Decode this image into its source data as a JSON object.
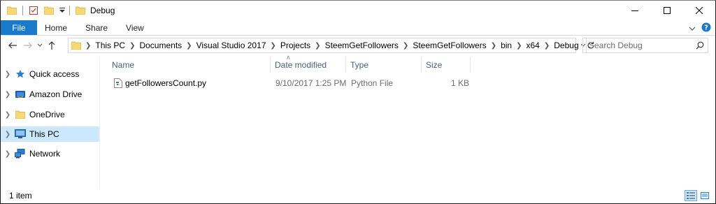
{
  "window": {
    "title": "Debug"
  },
  "ribbon": {
    "tabs": [
      "File",
      "Home",
      "Share",
      "View"
    ]
  },
  "address": {
    "crumbs": [
      "This PC",
      "Documents",
      "Visual Studio 2017",
      "Projects",
      "SteemGetFollowers",
      "SteemGetFollowers",
      "bin",
      "x64",
      "Debug"
    ]
  },
  "search": {
    "placeholder": "Search Debug"
  },
  "nav": {
    "items": [
      {
        "label": "Quick access",
        "icon": "star-icon"
      },
      {
        "label": "Amazon Drive",
        "icon": "amazon-drive-icon"
      },
      {
        "label": "OneDrive",
        "icon": "folder-icon"
      },
      {
        "label": "This PC",
        "icon": "monitor-icon",
        "selected": true
      },
      {
        "label": "Network",
        "icon": "network-icon"
      }
    ]
  },
  "columns": [
    "Name",
    "Date modified",
    "Type",
    "Size"
  ],
  "files": [
    {
      "name": "getFollowersCount.py",
      "date": "9/10/2017 1:25 PM",
      "type": "Python File",
      "size": "1 KB"
    }
  ],
  "status": {
    "count": "1 item"
  },
  "colors": {
    "accent": "#1979ca",
    "selected": "#cce8ff",
    "folder": "#f8d775"
  }
}
